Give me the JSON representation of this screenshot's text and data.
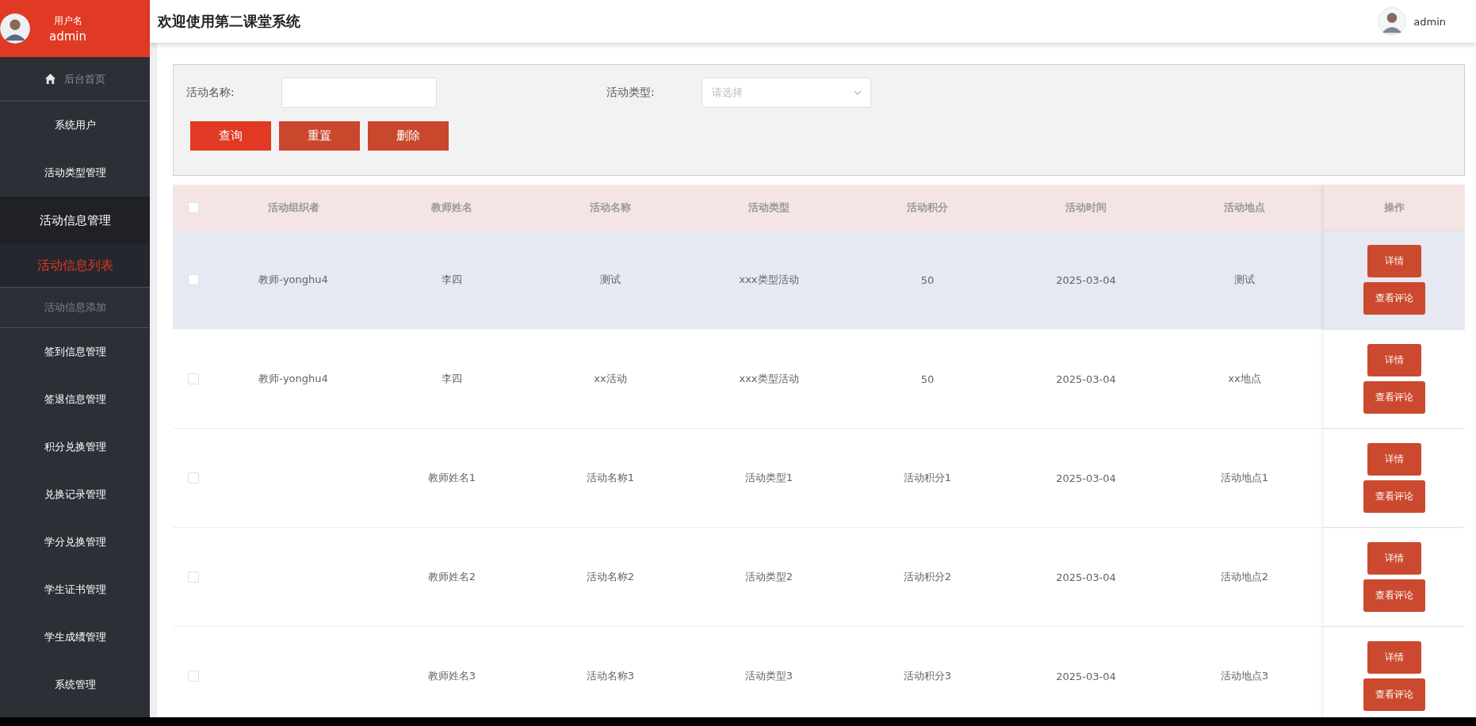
{
  "sidebar": {
    "user_label": "用户名",
    "user_name": "admin",
    "items": [
      {
        "label": "后台首页",
        "kind": "home",
        "selected": false
      },
      {
        "label": "系统用户",
        "kind": "item",
        "selected": false
      },
      {
        "label": "活动类型管理",
        "kind": "item",
        "selected": false
      },
      {
        "label": "活动信息管理",
        "kind": "group",
        "expanded": true,
        "selected": false,
        "children": [
          {
            "label": "活动信息列表",
            "selected": true
          },
          {
            "label": "活动信息添加",
            "selected": false
          }
        ]
      },
      {
        "label": "签到信息管理",
        "kind": "item",
        "selected": false
      },
      {
        "label": "签退信息管理",
        "kind": "item",
        "selected": false
      },
      {
        "label": "积分兑换管理",
        "kind": "item",
        "selected": false
      },
      {
        "label": "兑换记录管理",
        "kind": "item",
        "selected": false
      },
      {
        "label": "学分兑换管理",
        "kind": "item",
        "selected": false
      },
      {
        "label": "学生证书管理",
        "kind": "item",
        "selected": false
      },
      {
        "label": "学生成绩管理",
        "kind": "item",
        "selected": false
      },
      {
        "label": "系统管理",
        "kind": "item",
        "selected": false
      }
    ]
  },
  "header": {
    "title": "欢迎使用第二课堂系统",
    "user_name": "admin"
  },
  "filters": [
    {
      "label": "活动名称:",
      "kind": "text"
    },
    {
      "label": "活动类型:",
      "kind": "select",
      "placeholder": "请选择"
    }
  ],
  "filter_buttons": [
    {
      "label": "查询",
      "kind": "primary"
    },
    {
      "label": "重置",
      "kind": "secondary"
    },
    {
      "label": "删除",
      "kind": "secondary"
    }
  ],
  "table": {
    "select_all_checked": false,
    "columns": [
      "活动组织者",
      "教师姓名",
      "活动名称",
      "活动类型",
      "活动积分",
      "活动时间",
      "活动地点",
      "操作"
    ],
    "rows": [
      {
        "checked": false,
        "hovered": true,
        "cells": [
          "教师-yonghu4",
          "李四",
          "测试",
          "xxx类型活动",
          "50",
          "2025-03-04",
          "测试"
        ],
        "actions": [
          "详情",
          "查看评论"
        ]
      },
      {
        "checked": false,
        "hovered": false,
        "cells": [
          "教师-yonghu4",
          "李四",
          "xx活动",
          "xxx类型活动",
          "50",
          "2025-03-04",
          "xx地点"
        ],
        "actions": [
          "详情",
          "查看评论"
        ]
      },
      {
        "checked": false,
        "hovered": false,
        "cells": [
          "",
          "教师姓名1",
          "活动名称1",
          "活动类型1",
          "活动积分1",
          "2025-03-04",
          "活动地点1"
        ],
        "actions": [
          "详情",
          "查看评论"
        ]
      },
      {
        "checked": false,
        "hovered": false,
        "cells": [
          "",
          "教师姓名2",
          "活动名称2",
          "活动类型2",
          "活动积分2",
          "2025-03-04",
          "活动地点2"
        ],
        "actions": [
          "详情",
          "查看评论"
        ]
      },
      {
        "checked": false,
        "hovered": false,
        "cells": [
          "",
          "教师姓名3",
          "活动名称3",
          "活动类型3",
          "活动积分3",
          "2025-03-04",
          "活动地点3"
        ],
        "actions": [
          "详情",
          "查看评论"
        ]
      }
    ]
  }
}
